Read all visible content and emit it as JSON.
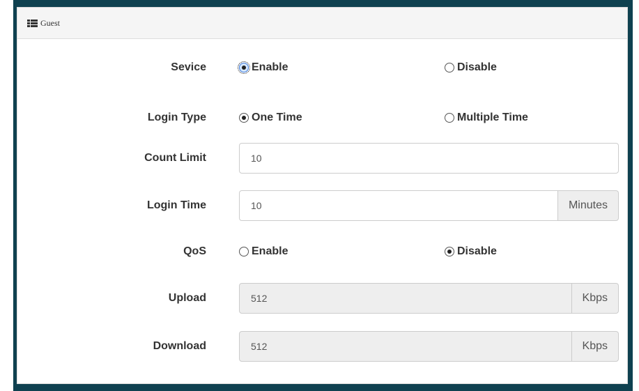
{
  "panel": {
    "title": "Guest",
    "icon": "list-icon"
  },
  "form": {
    "service": {
      "label": "Sevice",
      "options": [
        "Enable",
        "Disable"
      ],
      "selected": "Enable"
    },
    "login_type": {
      "label": "Login Type",
      "options": [
        "One Time",
        "Multiple Time"
      ],
      "selected": "One Time"
    },
    "count_limit": {
      "label": "Count Limit",
      "value": "10"
    },
    "login_time": {
      "label": "Login Time",
      "value": "10",
      "unit": "Minutes"
    },
    "qos": {
      "label": "QoS",
      "options": [
        "Enable",
        "Disable"
      ],
      "selected": "Disable"
    },
    "upload": {
      "label": "Upload",
      "value": "512",
      "unit": "Kbps",
      "disabled": true
    },
    "download": {
      "label": "Download",
      "value": "512",
      "unit": "Kbps",
      "disabled": true
    }
  },
  "colors": {
    "frame": "#0f4150",
    "heading_bg": "#f5f5f5",
    "addon_bg": "#eeeeee",
    "disabled_bg": "#eeeeee"
  }
}
